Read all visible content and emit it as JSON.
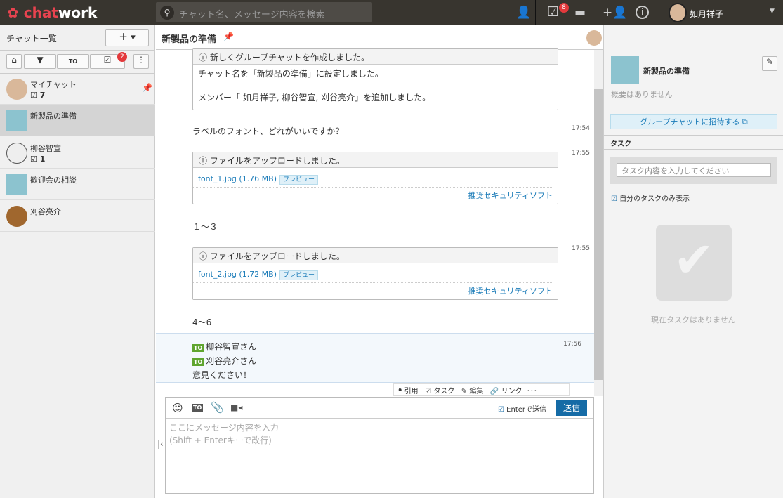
{
  "topbar": {
    "logo_a": "chat",
    "logo_b": "work",
    "search_placeholder": "チャット名、メッセージ内容を検索",
    "task_badge": "8",
    "user_name": "如月祥子"
  },
  "sidebar": {
    "title": "チャット一覧",
    "add_label": "＋ ▾",
    "filter_task_badge": "2",
    "items": [
      {
        "name": "マイチャット",
        "count": "7"
      },
      {
        "name": "新製品の準備"
      },
      {
        "name": "柳谷智宣",
        "count": "1"
      },
      {
        "name": "歓迎会の相談"
      },
      {
        "name": "刈谷亮介"
      }
    ]
  },
  "chat": {
    "title": "新製品の準備",
    "sys1": {
      "header": "新しくグループチャットを作成しました。",
      "line1": "チャット名を「新製品の準備」に設定しました。",
      "line2_a": "メンバー「",
      "m1": "如月祥子,",
      "m2": "柳谷智宣,",
      "m3": "刈谷亮介",
      "line2_b": "」を追加しました。"
    },
    "msg1": {
      "text": "ラベルのフォント、どれがいいですか？",
      "time": "17:54"
    },
    "file1": {
      "time": "17:55",
      "header": "ファイルをアップロードしました。",
      "file": "font_1.jpg (1.76 MB)",
      "preview": "プレビュー",
      "security": "推奨セキュリティソフト"
    },
    "msg2": {
      "text": "１～３"
    },
    "file2": {
      "time": "17:55",
      "header": "ファイルをアップロードしました。",
      "file": "font_2.jpg (1.72 MB)",
      "preview": "プレビュー",
      "security": "推奨セキュリティソフト"
    },
    "msg3": {
      "text": "4～6"
    },
    "msg4": {
      "time": "17:56",
      "to": "TO",
      "to1": "柳谷智宣さん",
      "to2": "刈谷亮介さん",
      "body": "意見ください！"
    },
    "actions": {
      "quote": "引用",
      "task": "タスク",
      "edit": "編集",
      "link": "リンク",
      "more": "･･･"
    },
    "composer": {
      "enter_send": "Enterで送信",
      "send": "送信",
      "placeholder1": "ここにメッセージ内容を入力",
      "placeholder2": "(Shift + Enterキーで改行)",
      "to": "TO"
    }
  },
  "right": {
    "room_name": "新製品の準備",
    "summary": "概要はありません",
    "invite": "グループチャットに招待する",
    "task_title": "タスク",
    "task_placeholder": "タスク内容を入力してください",
    "my_tasks": "自分のタスクのみ表示",
    "no_tasks": "現在タスクはありません"
  }
}
